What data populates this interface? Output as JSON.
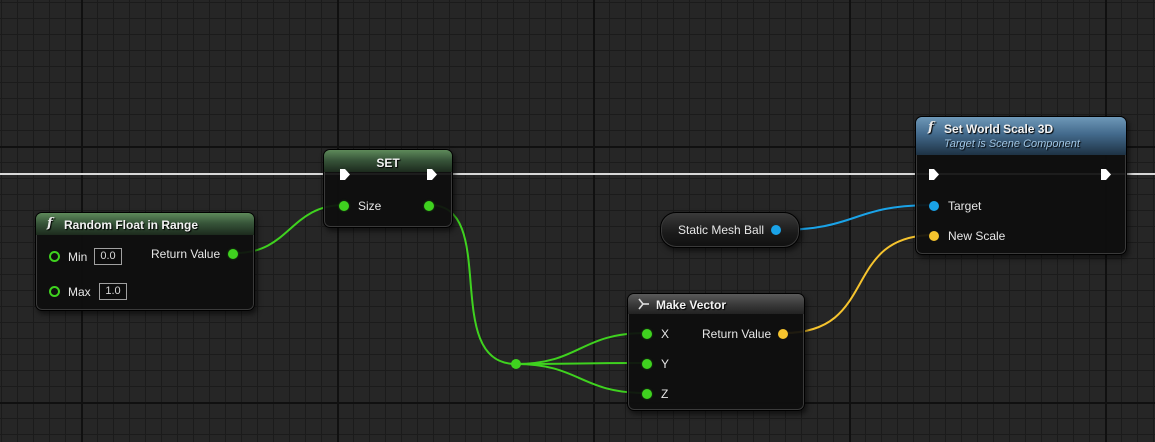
{
  "nodes": {
    "random_float": {
      "title": "Random Float in Range",
      "func_icon": "f",
      "inputs": [
        {
          "label": "Min",
          "value": "0.0"
        },
        {
          "label": "Max",
          "value": "1.0"
        }
      ],
      "output": "Return Value"
    },
    "set": {
      "title": "SET",
      "input": "Size"
    },
    "static_mesh": {
      "label": "Static Mesh Ball"
    },
    "make_vector": {
      "title": "Make Vector",
      "inputs": [
        "X",
        "Y",
        "Z"
      ],
      "output": "Return Value"
    },
    "set_world_scale": {
      "title": "Set World Scale 3D",
      "subtitle": "Target is Scene Component",
      "func_icon": "f",
      "inputs": [
        "Target",
        "New Scale"
      ]
    }
  },
  "colors": {
    "float_pin": "#3fd21f",
    "object_pin": "#1aa3e8",
    "vector_pin": "#f6c42e",
    "exec_wire": "#ffffff"
  },
  "icons": [
    "function-icon",
    "exec-pin-icon",
    "make-struct-icon"
  ]
}
